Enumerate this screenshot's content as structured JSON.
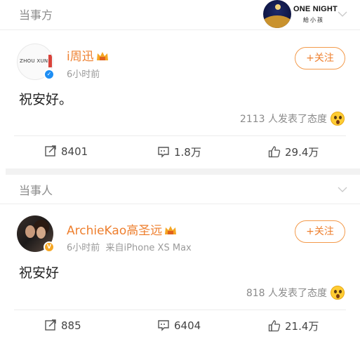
{
  "sections": [
    {
      "title": "当事方",
      "badge": {
        "line1": "ONE NIGHT",
        "line2": "給小孩"
      },
      "post": {
        "avatar_text": "ZHOU XUN",
        "username": "i周迅",
        "time": "6小时前",
        "source": "",
        "follow_label": "+关注",
        "text": "祝安好。",
        "attitude_text": "2113 人发表了态度",
        "reposts": "8401",
        "comments": "1.8万",
        "likes": "29.4万"
      }
    },
    {
      "title": "当事人",
      "post": {
        "username": "ArchieKao高圣远",
        "time": "6小时前",
        "source": "来自iPhone XS Max",
        "follow_label": "+关注",
        "text": "祝安好",
        "attitude_text": "818 人发表了态度",
        "reposts": "885",
        "comments": "6404",
        "likes": "21.4万"
      }
    }
  ],
  "icons": {
    "repost": "repost-icon",
    "comment": "comment-icon",
    "like": "thumbs-up-icon",
    "verified_blue": "verified-blue-icon",
    "verified_gold": "verified-gold-icon",
    "crown": "vip-crown-icon",
    "emoji": "surprised-emoji-icon",
    "chevron": "chevron-down-icon"
  },
  "colors": {
    "username": "#ee7f2e",
    "follow_border": "#f39a4b",
    "meta": "#9a9a9a",
    "verified_blue": "#1e8ef4",
    "verified_gold": "#f5a623"
  }
}
